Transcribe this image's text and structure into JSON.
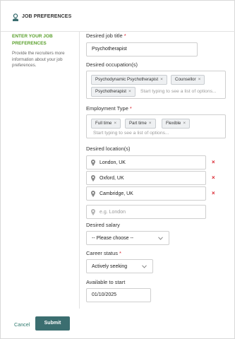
{
  "header": {
    "title": "JOB PREFERENCES",
    "icon": "person-badge-icon"
  },
  "sidebar": {
    "title": "ENTER YOUR JOB PREFERENCES",
    "description": "Provide the recruiters more information about your job preferences."
  },
  "form": {
    "job_title": {
      "label": "Desired job title",
      "required": "*",
      "value": "Psychotherapist"
    },
    "occupations": {
      "label": "Desired occupation(s)",
      "tags": [
        "Psychodynamic Psychotherapist",
        "Counsellor",
        "Psychotherapist"
      ],
      "placeholder": "Start typing to see a list of options..."
    },
    "employment_type": {
      "label": "Employment Type",
      "required": "*",
      "tags": [
        "Full time",
        "Part time",
        "Flexible"
      ],
      "placeholder": "Start typing to see a list of options..."
    },
    "locations": {
      "label": "Desired location(s)",
      "items": [
        "London, UK",
        "Oxford, UK",
        "Cambridge, UK"
      ],
      "placeholder": "e.g. London",
      "remove_glyph": "×"
    },
    "salary": {
      "label": "Desired salary",
      "value": "-- Please choose --"
    },
    "career_status": {
      "label": "Career status",
      "required": "*",
      "value": "Actively seeking"
    },
    "available": {
      "label": "Available to start",
      "value": "01/10/2025"
    },
    "tag_remove_glyph": "×"
  },
  "actions": {
    "cancel": "Cancel",
    "submit": "Submit"
  },
  "colors": {
    "accent_green": "#5aa02c",
    "remove_red": "#d9232d",
    "submit_bg": "#3b6e70",
    "link": "#2f7a6e"
  }
}
